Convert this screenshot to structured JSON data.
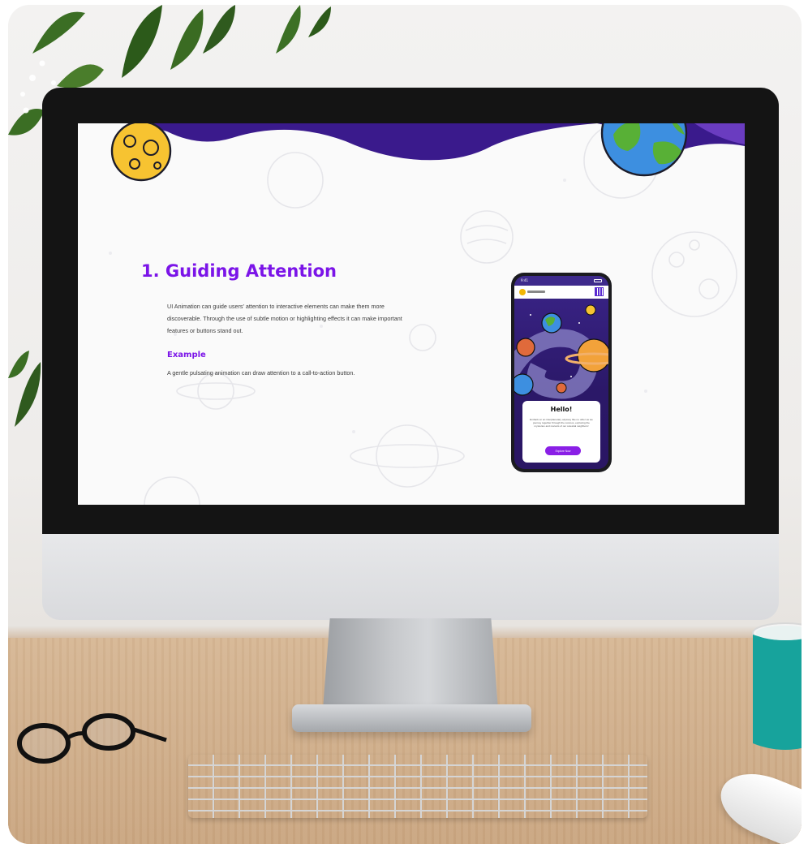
{
  "screen": {
    "heading": "1. Guiding Attention",
    "body": "UI Animation can guide users' attention to interactive elements can make them more discoverable. Through the use of subtle motion or highlighting effects it can make important features or buttons stand out.",
    "subheading": "Example",
    "example_text": "A gentle pulsating animation can draw attention to a call-to-action button."
  },
  "phone": {
    "status_time": "9:41",
    "card_title": "Hello!",
    "card_body": "Embark on an interplanetary odyssey like no other as we journey together through the cosmos, exploring the mysteries and marvels of our celestial neighbors!",
    "cta_label": "Explore Now"
  },
  "colors": {
    "accent_purple": "#7b14e8",
    "wave_purple": "#3a1a8c",
    "button_purple": "#8a1fe6",
    "mug_teal": "#17a39c"
  },
  "icons": [
    "moon-icon",
    "earth-icon",
    "saturn-icon",
    "qr-code-icon"
  ]
}
